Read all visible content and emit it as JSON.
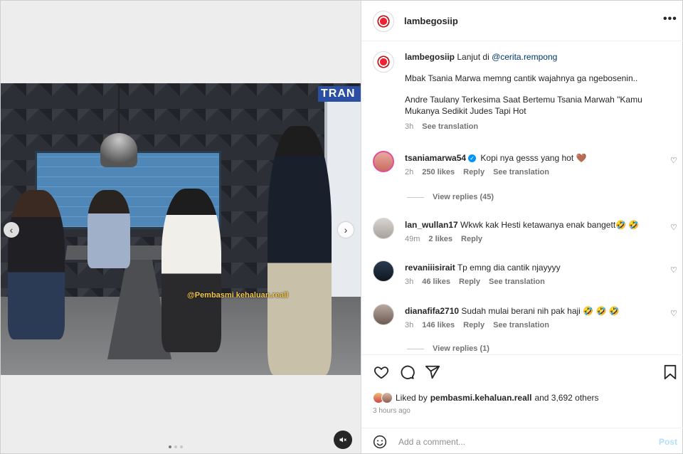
{
  "media": {
    "overlay_brand": "TRAN",
    "overlay_watermark": "@Pembasmi kehaluan.reall",
    "prev_label": "‹",
    "next_label": "›",
    "mute_icon": "speaker-muted-icon",
    "carousel_pages": 3,
    "carousel_active": 0
  },
  "header": {
    "username": "lambegosiip",
    "more_label": "•••"
  },
  "caption": {
    "username": "lambegosiip",
    "lead": "Lanjut di",
    "mention": "@cerita.rempong",
    "line2": "Mbak Tsania Marwa memng cantik wajahnya ga ngebosenin..",
    "line3": "Andre Taulany Terkesima Saat Bertemu Tsania Marwah \"Kamu Mukanya Sedikit Judes Tapi Hot",
    "time": "3h",
    "see_translation": "See translation"
  },
  "comments": [
    {
      "username": "tsaniamarwa54",
      "verified": true,
      "text": "Kopi nya gesss yang hot 🤎",
      "time": "2h",
      "likes": "250 likes",
      "reply": "Reply",
      "see_translation": "See translation",
      "view_replies": "View replies (45)"
    },
    {
      "username": "lan_wullan17",
      "text": "Wkwk kak Hesti ketawanya enak bangett🤣 🤣",
      "time": "49m",
      "likes": "2 likes",
      "reply": "Reply"
    },
    {
      "username": "revaniiisirait",
      "text": "Tp emng dia cantik njayyyy",
      "time": "3h",
      "likes": "46 likes",
      "reply": "Reply",
      "see_translation": "See translation"
    },
    {
      "username": "dianafifa2710",
      "text": "Sudah mulai berani nih pak haji 🤣 🤣 🤣",
      "time": "3h",
      "likes": "146 likes",
      "reply": "Reply",
      "see_translation": "See translation",
      "view_replies": "View replies (1)"
    }
  ],
  "actions": {
    "liked_by_prefix": "Liked by",
    "liked_by_user": "pembasmi.kehaluan.reall",
    "liked_by_suffix": "and 3,692 others",
    "time_ago": "3 hours ago"
  },
  "add_comment": {
    "placeholder": "Add a comment...",
    "post_label": "Post"
  }
}
